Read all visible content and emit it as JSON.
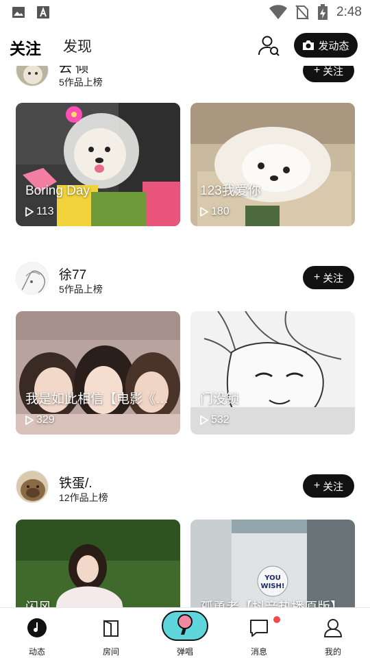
{
  "status_bar": {
    "time": "2:48",
    "icons": [
      "image-icon",
      "text-a-icon",
      "wifi-icon",
      "no-sim-icon",
      "battery-charging-icon"
    ]
  },
  "header": {
    "tabs": [
      {
        "label": "关注",
        "active": true
      },
      {
        "label": "发现",
        "active": false
      }
    ],
    "post_button_label": "发动态"
  },
  "feed": [
    {
      "user_name": "云 倾",
      "user_sub": "5作品上榜",
      "follow_label": "关注",
      "posts": [
        {
          "title": "Boring Day",
          "plays": "113"
        },
        {
          "title": "123我爱你",
          "plays": "180"
        }
      ]
    },
    {
      "user_name": "徐77",
      "user_sub": "5作品上榜",
      "follow_label": "关注",
      "posts": [
        {
          "title": "我是如此相信【电影《…",
          "plays": "329"
        },
        {
          "title": "门没锁",
          "plays": "532"
        }
      ]
    },
    {
      "user_name": "铁蛋/.",
      "user_sub": "12作品上榜",
      "follow_label": "关注",
      "posts": [
        {
          "title": "闪风",
          "plays": ""
        },
        {
          "title": "孤勇者【抖音热播原版】",
          "plays": ""
        }
      ]
    }
  ],
  "bottom_nav": [
    {
      "label": "动态",
      "icon": "music-note-icon",
      "active": true
    },
    {
      "label": "房间",
      "icon": "door-icon",
      "active": false
    },
    {
      "label": "弹唱",
      "icon": "microphone-icon",
      "active": false
    },
    {
      "label": "消息",
      "icon": "chat-bubble-icon",
      "active": false,
      "has_badge": true
    },
    {
      "label": "我的",
      "icon": "person-icon",
      "active": false
    }
  ],
  "colors": {
    "accent_teal": "#5fd5dc",
    "badge_red": "#f04a4a",
    "button_black": "#111111"
  }
}
